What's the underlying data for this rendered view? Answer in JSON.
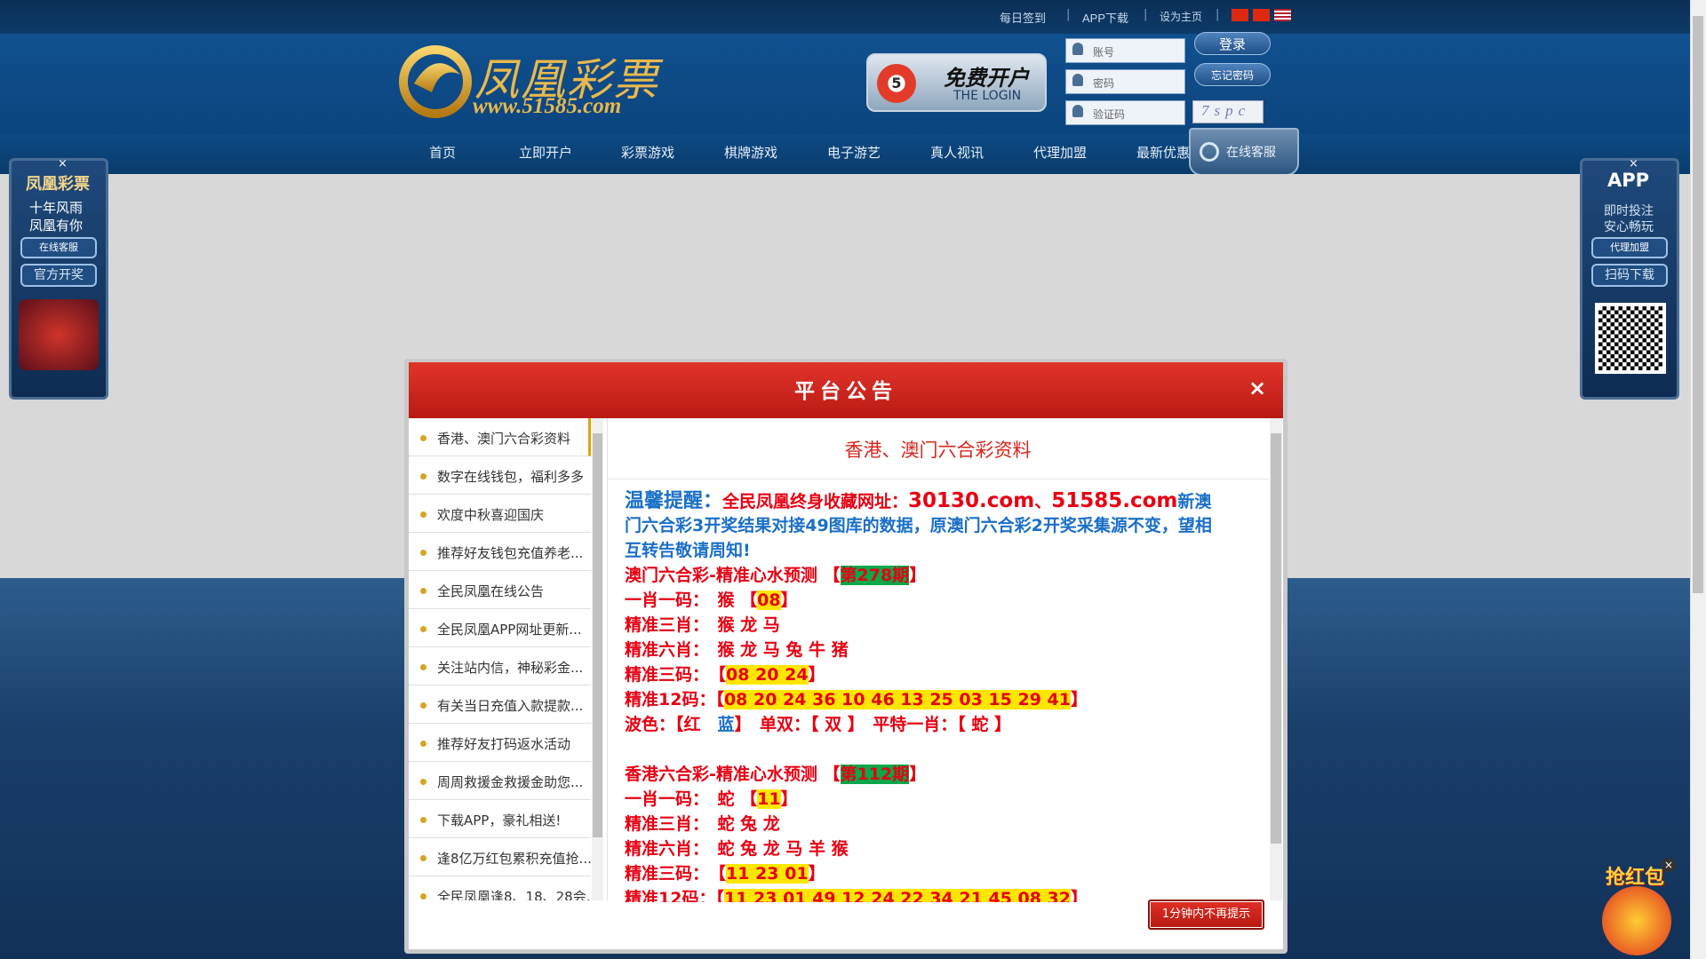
{
  "topbar": {
    "checkin": "每日签到",
    "app_download": "APP下载",
    "set_home": "设为主页",
    "separators": [
      "|",
      "|",
      "|"
    ]
  },
  "header": {
    "logo_text": "凤凰彩票",
    "logo_url": "www.51585.com",
    "promo_title": "免费开户",
    "promo_sub": "THE LOGIN",
    "promo_ball": "5",
    "account_placeholder": "账号",
    "password_placeholder": "密码",
    "captcha_placeholder": "验证码",
    "captcha_code": "7spc",
    "login_button": "登录",
    "forgot_button": "忘记密码"
  },
  "nav": {
    "items": [
      "首页",
      "立即开户",
      "彩票游戏",
      "棋牌游戏",
      "电子游艺",
      "真人视讯",
      "代理加盟",
      "最新优惠"
    ],
    "online_service": "在线客服"
  },
  "left_float": {
    "brand": "凤凰彩票",
    "slogan1": "十年风雨",
    "slogan2": "凤凰有你",
    "btn1": "在线客服",
    "btn2": "官方开奖",
    "close": "×"
  },
  "right_float": {
    "app": "APP",
    "line1": "即时投注",
    "line2": "安心畅玩",
    "btn1": "代理加盟",
    "btn2": "扫码下载",
    "close": "×"
  },
  "red_packet": {
    "label": "抢红包",
    "close": "×"
  },
  "modal": {
    "title": "平台公告",
    "close": "×",
    "no_more_button": "1分钟内不再提示",
    "list": [
      "香港、澳门六合彩资料",
      "数字在线钱包，福利多多",
      "欢度中秋喜迎国庆",
      "推荐好友钱包充值养老...",
      "全民凤凰在线公告",
      "全民凤凰APP网址更新...",
      "关注站内信，神秘彩金...",
      "有关当日充值入款提款...",
      "推荐好友打码返水活动",
      "周周救援金救援金助您...",
      "下载APP，豪礼相送!",
      "逢8亿万红包累积充值抢...",
      "全民凤凰逢8、18、28会..."
    ],
    "content": {
      "title": "香港、澳门六合彩资料",
      "notice_label": "温馨提醒：",
      "notice_text1": "全民凤凰终身收藏网址：",
      "domain1": "30130.com",
      "dot": "、",
      "domain2": "51585.com",
      "notice_text2": "新澳",
      "notice_line2": "门六合彩3开奖结果对接49图库的数据，原澳门六合彩2开奖采集源不变，望相",
      "notice_line3": "互转告敬请周知!",
      "macau": {
        "header": "澳门六合彩-精准心水预测 【",
        "period": "第278期",
        "header_end": "】",
        "one_code_label": "一肖一码：　猴 【",
        "one_code": "08",
        "one_code_end": "】",
        "three_xiao": "精准三肖：　猴 龙 马",
        "six_xiao": "精准六肖：　猴 龙 马 兔 牛 猪",
        "three_code_label": "精准三码：　【",
        "three_code": "08 20 24",
        "three_code_end": "】",
        "twelve_label": "精准12码：【",
        "twelve_code": "08 20 24 36 10 46 13 25 03 15 29 41",
        "twelve_end": "】",
        "wave_label": "波色：【红　",
        "wave_blue": "蓝",
        "wave_rest": "】　单双：【 双 】　平特一肖：【 蛇 】"
      },
      "hongkong": {
        "header": "香港六合彩-精准心水预测 【",
        "period": "第112期",
        "header_end": "】",
        "one_code_label": "一肖一码：　蛇 【",
        "one_code": "11",
        "one_code_end": "】",
        "three_xiao": "精准三肖：　蛇 兔 龙",
        "six_xiao": "精准六肖：　蛇 兔 龙 马 羊 猴",
        "three_code_label": "精准三码：　【",
        "three_code": "11 23 01",
        "three_code_end": "】",
        "twelve_label": "精准12码：【",
        "twelve_code": "11 23 01 49 12 24 22 34 21 45 08 32",
        "twelve_end": "】"
      }
    }
  },
  "colors": {
    "modal_header": "#c8211a",
    "accent_red": "#e60012",
    "accent_blue": "#1a6fc8",
    "highlight_yellow": "#ffe600",
    "highlight_green": "#0aa84a",
    "nav_bg": "#0c457e"
  }
}
